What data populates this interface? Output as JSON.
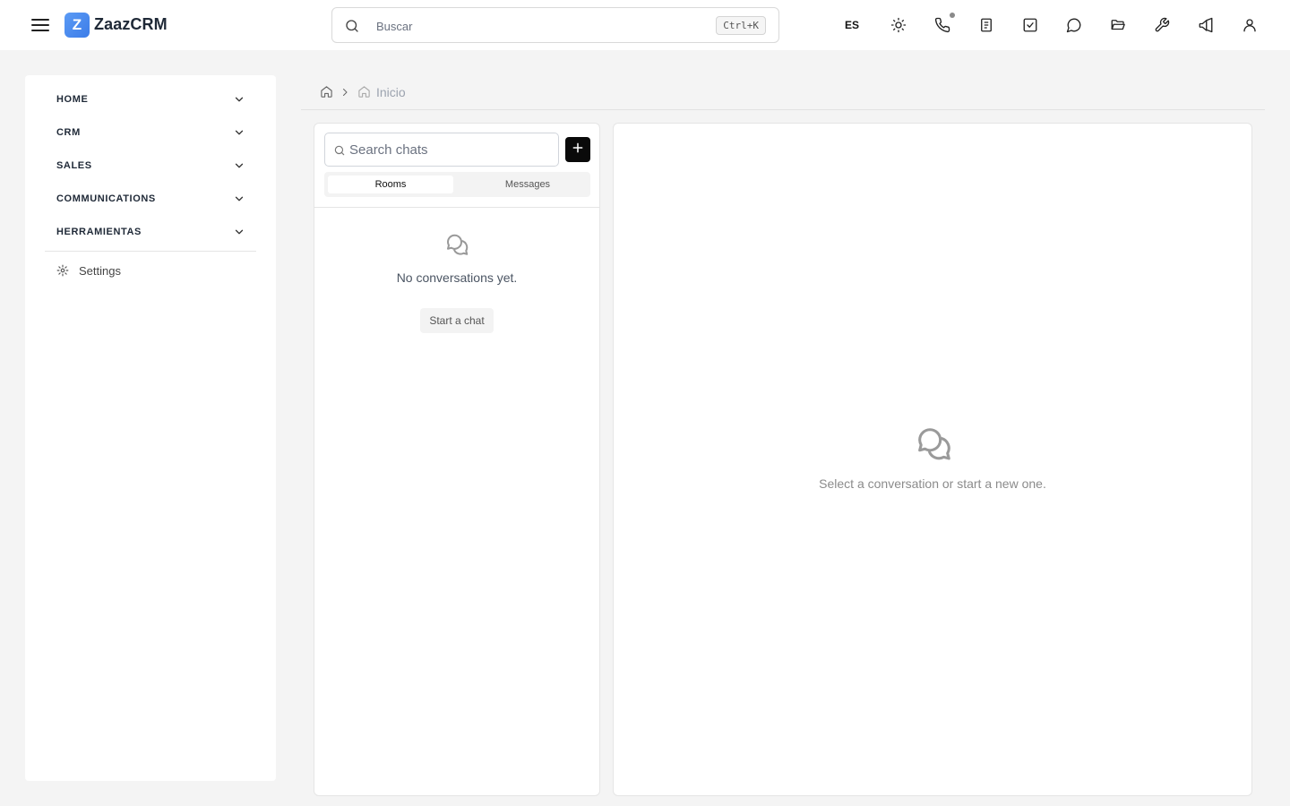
{
  "app": {
    "logo_letter": "Z",
    "name": "ZaazCRM"
  },
  "search": {
    "placeholder": "Buscar",
    "shortcut": "Ctrl+K"
  },
  "header": {
    "language": "ES",
    "icons": [
      "sun-icon",
      "phone-icon",
      "notes-icon",
      "tasks-icon",
      "chat-icon",
      "folder-icon",
      "wrench-icon",
      "megaphone-icon",
      "user-icon"
    ]
  },
  "sidebar": {
    "items": [
      {
        "label": "HOME"
      },
      {
        "label": "CRM"
      },
      {
        "label": "SALES"
      },
      {
        "label": "COMMUNICATIONS"
      },
      {
        "label": "HERRAMIENTAS"
      }
    ],
    "settings_label": "Settings"
  },
  "breadcrumb": {
    "current": "Inicio"
  },
  "chat_list": {
    "search_placeholder": "Search chats",
    "tabs": [
      {
        "label": "Rooms",
        "active": true
      },
      {
        "label": "Messages",
        "active": false
      }
    ],
    "empty_text": "No conversations yet.",
    "start_label": "Start a chat"
  },
  "conversation": {
    "empty_text": "Select a conversation or start a new one."
  },
  "colors": {
    "brand": "#3c7ce8",
    "background": "#f4f4f4",
    "primary_button": "#0a0a0a"
  }
}
